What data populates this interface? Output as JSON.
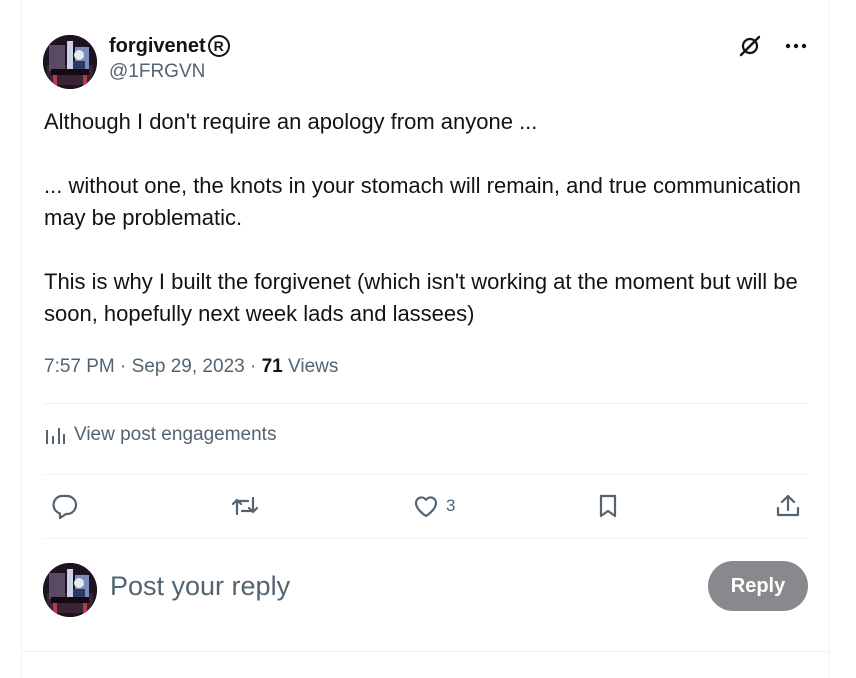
{
  "author": {
    "display_name": "forgivenet",
    "registered_mark": "R",
    "handle": "@1FRGVN",
    "avatar": "piano-player-avatar"
  },
  "header_icons": {
    "grok": "grok-icon",
    "more": "more-icon"
  },
  "post": {
    "paragraphs": [
      "Although I don't require an apology from anyone ...",
      "... without one, the knots in your stomach will remain, and true communication may be problematic.",
      "This is why I built the forgivenet (which isn't working at the moment but will be soon, hopefully next week lads and lassees)"
    ],
    "time": "7:57 PM",
    "date": "Sep 29, 2023",
    "separator": "·",
    "views_count": "71",
    "views_label": "Views"
  },
  "engagements": {
    "label": "View post engagements",
    "icon": "analytics-icon"
  },
  "actions": {
    "reply_icon": "reply-icon",
    "repost_icon": "repost-icon",
    "like_icon": "like-icon",
    "like_count": "3",
    "bookmark_icon": "bookmark-icon",
    "share_icon": "share-icon"
  },
  "reply_box": {
    "placeholder": "Post your reply",
    "button_label": "Reply",
    "button_color": "#87898c"
  },
  "colors": {
    "text": "#0f1419",
    "secondary": "#536471",
    "divider": "#eff3f4"
  }
}
